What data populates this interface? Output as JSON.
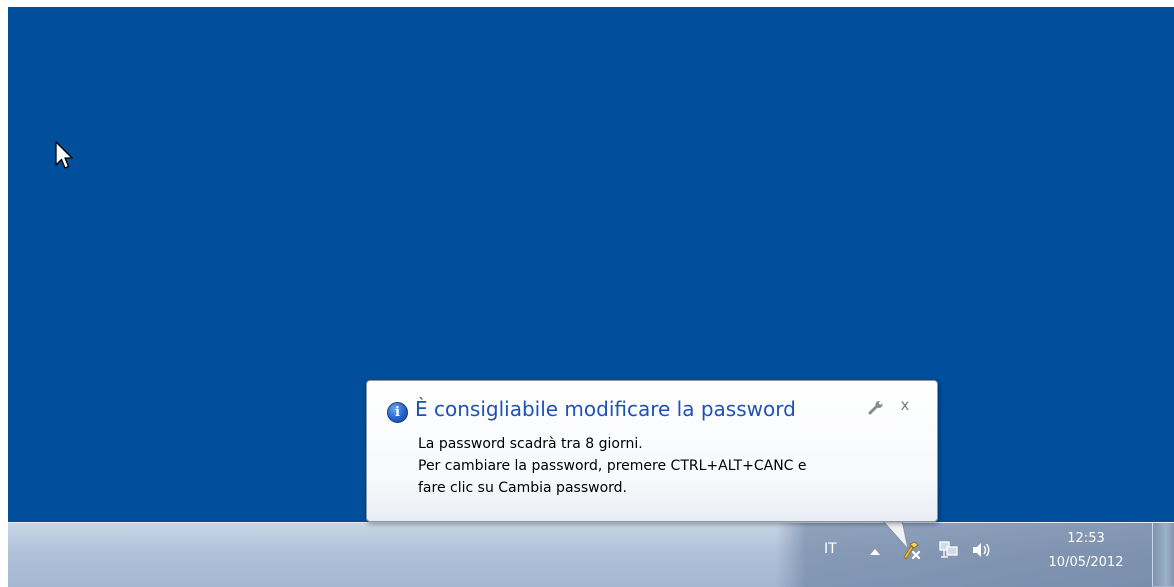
{
  "notification": {
    "icon": "info-icon",
    "title": "È consigliabile modificare la password",
    "lines": [
      "La password scadrà tra 8 giorni.",
      "Per cambiare la password, premere CTRL+ALT+CANC e",
      "fare clic su Cambia password."
    ],
    "options_icon": "wrench-icon",
    "close_label": "x"
  },
  "taskbar": {
    "language": "IT",
    "clock": {
      "time": "12:53",
      "date": "10/05/2012"
    },
    "tray_icons": [
      "show-hidden-icons-arrow",
      "action-center-icon",
      "network-icon",
      "volume-icon"
    ]
  },
  "colors": {
    "desktop": "#014e9d",
    "title_text": "#1e52b4"
  }
}
